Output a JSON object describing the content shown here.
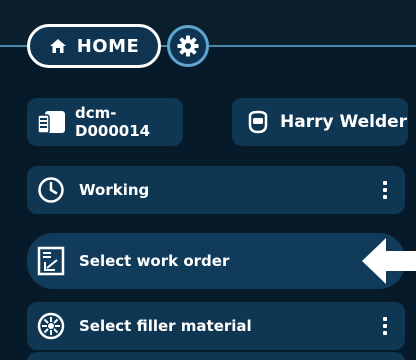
{
  "header": {
    "home_label": "HOME"
  },
  "device": {
    "id": "dcm-D000014",
    "icon": "device-icon"
  },
  "user": {
    "name": "Harry Welder",
    "icon": "welder-helmet-icon"
  },
  "menu": {
    "items": [
      {
        "label": "Working",
        "icon": "clock-icon",
        "has_menu": true
      },
      {
        "label": "Select work order",
        "icon": "work-order-icon",
        "highlighted": true
      },
      {
        "label": "Select filler material",
        "icon": "filler-spool-icon",
        "has_menu": true
      }
    ]
  },
  "colors": {
    "background": "#000000",
    "panel": "#0f3754",
    "accent": "#5ea6d0",
    "text": "#ffffff"
  }
}
